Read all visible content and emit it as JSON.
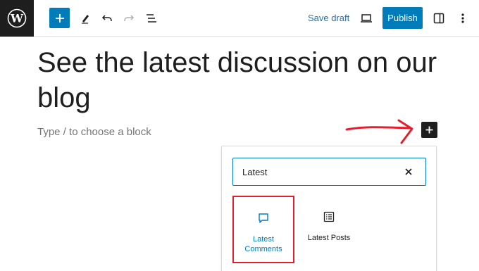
{
  "toolbar": {
    "logo_icon": "wordpress-logo-icon",
    "add_block_icon": "plus-icon",
    "tools_icon": "pencil-icon",
    "undo_icon": "undo-icon",
    "redo_icon": "redo-icon",
    "list_view_icon": "list-view-icon",
    "save_draft_label": "Save draft",
    "preview_icon": "laptop-icon",
    "publish_label": "Publish",
    "settings_icon": "sidebar-toggle-icon",
    "options_icon": "more-vertical-icon"
  },
  "editor": {
    "title": "See the latest discussion on our blog",
    "placeholder": "Type / to choose a block",
    "annotation_arrow_color": "#e1202e",
    "inserter_icon": "plus-icon"
  },
  "inserter": {
    "search_value": "Latest",
    "clear_icon": "close-icon",
    "blocks": [
      {
        "label": "Latest Comments",
        "icon": "comment-icon",
        "highlighted": true
      },
      {
        "label": "Latest Posts",
        "icon": "post-list-icon",
        "highlighted": false
      }
    ]
  },
  "colors": {
    "accent": "#007cba",
    "highlight": "#e1202e",
    "dark": "#1e1e1e"
  }
}
